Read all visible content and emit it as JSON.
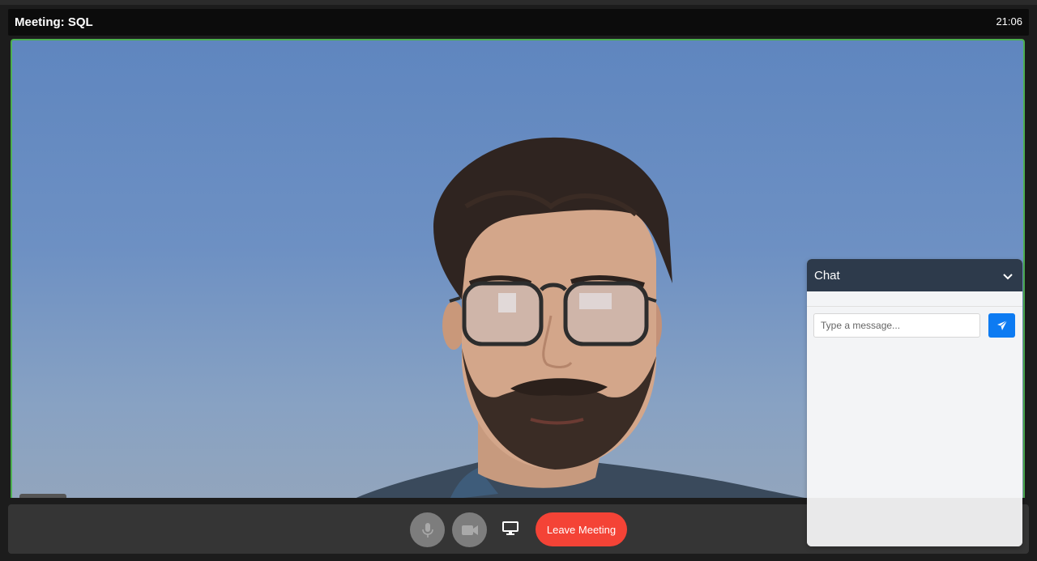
{
  "header": {
    "title": "Meeting: SQL",
    "clock": "21:06"
  },
  "video": {
    "participant_image": "participant-video-feed"
  },
  "controls": {
    "mic_icon": "microphone-icon",
    "camera_icon": "video-camera-icon",
    "screen_icon": "monitor-icon",
    "leave_label": "Leave Meeting"
  },
  "chat": {
    "title": "Chat",
    "input_placeholder": "Type a message...",
    "input_value": "",
    "toggle_icon": "chevron-down-icon",
    "send_icon": "paper-plane-icon"
  },
  "colors": {
    "active_border": "#4caf50",
    "leave": "#f44336",
    "chat_header": "#2d3a4b",
    "send": "#0d7bf2"
  }
}
